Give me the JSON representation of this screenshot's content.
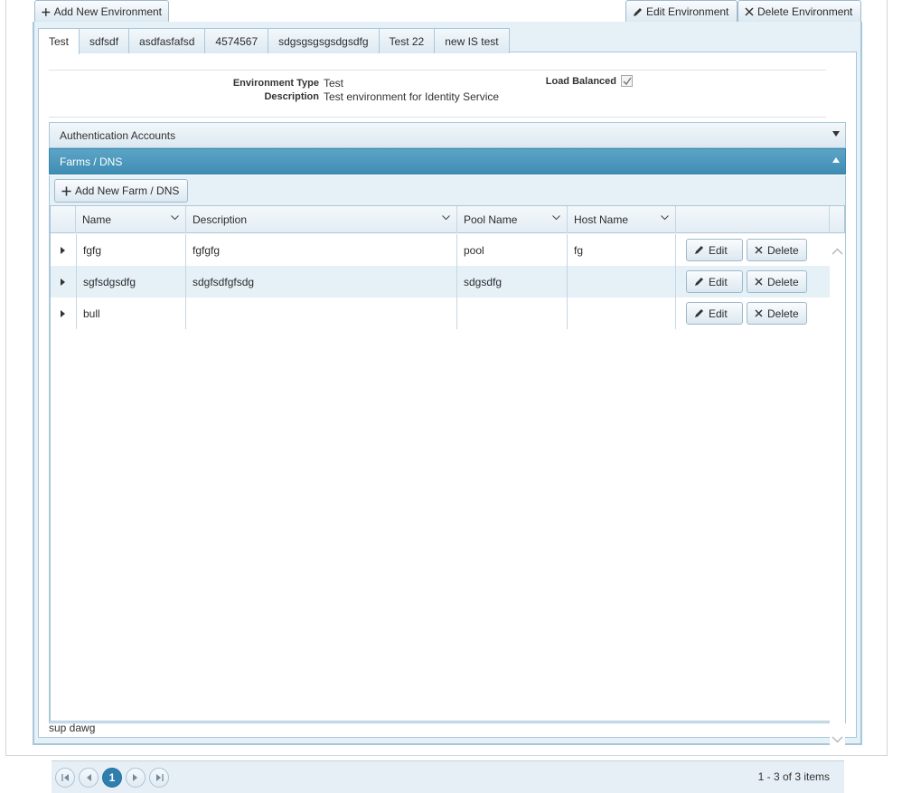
{
  "toolbar": {
    "add_environment_label": "Add New Environment",
    "edit_environment_label": "Edit Environment",
    "delete_environment_label": "Delete Environment"
  },
  "tabs": [
    {
      "label": "Test",
      "active": true
    },
    {
      "label": "sdfsdf",
      "active": false
    },
    {
      "label": "asdfasfafsd",
      "active": false
    },
    {
      "label": "4574567",
      "active": false
    },
    {
      "label": "sdgsgsgsgsdgsdfg",
      "active": false
    },
    {
      "label": "Test 22",
      "active": false
    },
    {
      "label": "new IS test",
      "active": false
    }
  ],
  "details": {
    "environment_type_label": "Environment Type",
    "environment_type_value": "Test",
    "description_label": "Description",
    "description_value": "Test environment for Identity Service",
    "load_balanced_label": "Load Balanced",
    "load_balanced_checked": true
  },
  "panels": {
    "auth_accounts_title": "Authentication Accounts",
    "farms_dns_title": "Farms / DNS"
  },
  "farms": {
    "add_label": "Add New Farm / DNS",
    "columns": [
      "Name",
      "Description",
      "Pool Name",
      "Host Name"
    ],
    "rows": [
      {
        "name": "fgfg",
        "description": "fgfgfg",
        "pool_name": "pool",
        "host_name": "fg"
      },
      {
        "name": "sgfsdgsdfg",
        "description": "sdgfsdfgfsdg",
        "pool_name": "sdgsdfg",
        "host_name": ""
      },
      {
        "name": "bull",
        "description": "",
        "pool_name": "",
        "host_name": ""
      }
    ],
    "edit_label": "Edit",
    "delete_label": "Delete"
  },
  "footer_note": "sup dawg",
  "pager": {
    "current_page": "1",
    "info": "1 - 3 of 3 items"
  },
  "colors": {
    "accent": "#3f8db4",
    "panel_border": "#a9c7db",
    "alt_row": "#e5f0f7"
  }
}
